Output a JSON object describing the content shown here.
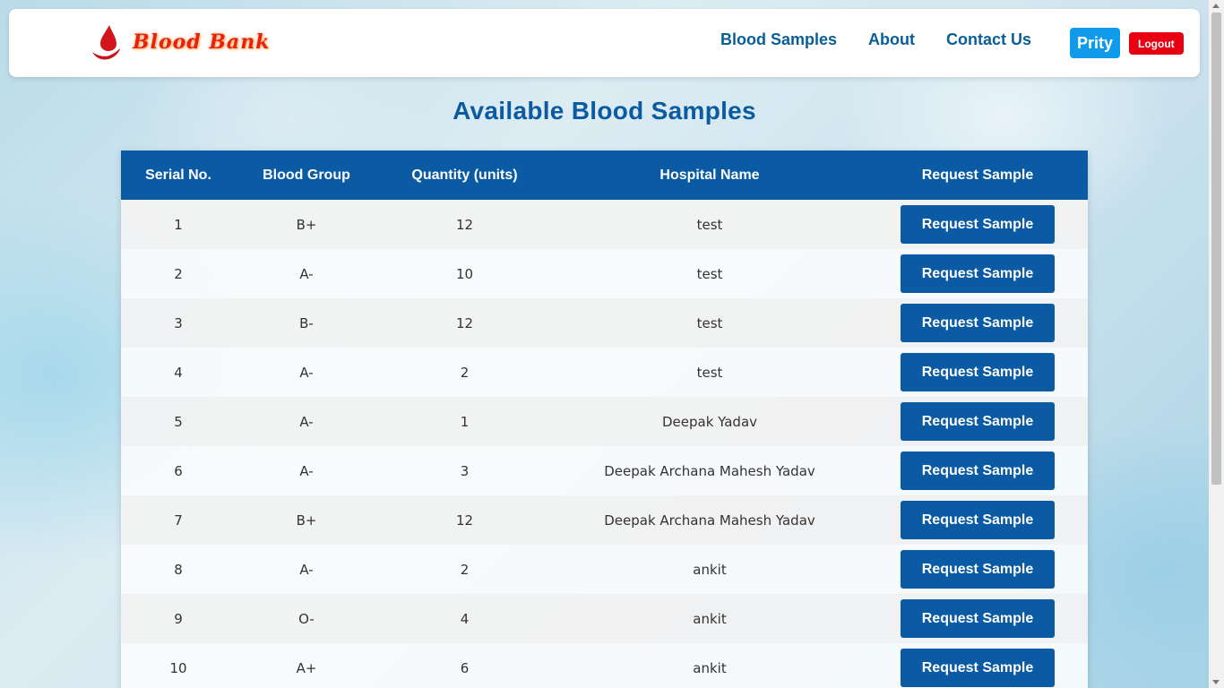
{
  "brand": {
    "name": "Blood Bank",
    "icon": "blood-drop-hand-icon",
    "color": "#e8220e"
  },
  "nav": {
    "links": [
      "Blood Samples",
      "About",
      "Contact Us"
    ],
    "user": "Prity",
    "logout": "Logout"
  },
  "main": {
    "title": "Available Blood Samples"
  },
  "table": {
    "columns": [
      "Serial No.",
      "Blood Group",
      "Quantity (units)",
      "Hospital Name",
      "Request Sample"
    ],
    "rows": [
      {
        "serial": "1",
        "group": "B+",
        "quantity": "12",
        "hospital": "test",
        "action": "Request Sample"
      },
      {
        "serial": "2",
        "group": "A-",
        "quantity": "10",
        "hospital": "test",
        "action": "Request Sample"
      },
      {
        "serial": "3",
        "group": "B-",
        "quantity": "12",
        "hospital": "test",
        "action": "Request Sample"
      },
      {
        "serial": "4",
        "group": "A-",
        "quantity": "2",
        "hospital": "test",
        "action": "Request Sample"
      },
      {
        "serial": "5",
        "group": "A-",
        "quantity": "1",
        "hospital": "Deepak Yadav",
        "action": "Request Sample"
      },
      {
        "serial": "6",
        "group": "A-",
        "quantity": "3",
        "hospital": "Deepak Archana Mahesh Yadav",
        "action": "Request Sample"
      },
      {
        "serial": "7",
        "group": "B+",
        "quantity": "12",
        "hospital": "Deepak Archana Mahesh Yadav",
        "action": "Request Sample"
      },
      {
        "serial": "8",
        "group": "A-",
        "quantity": "2",
        "hospital": "ankit",
        "action": "Request Sample"
      },
      {
        "serial": "9",
        "group": "O-",
        "quantity": "4",
        "hospital": "ankit",
        "action": "Request Sample"
      },
      {
        "serial": "10",
        "group": "A+",
        "quantity": "6",
        "hospital": "ankit",
        "action": "Request Sample"
      }
    ]
  },
  "colors": {
    "primary": "#0a5ba4",
    "user_button": "#0f9bea",
    "logout_button": "#e60012",
    "nav_link": "#0a5e96"
  }
}
